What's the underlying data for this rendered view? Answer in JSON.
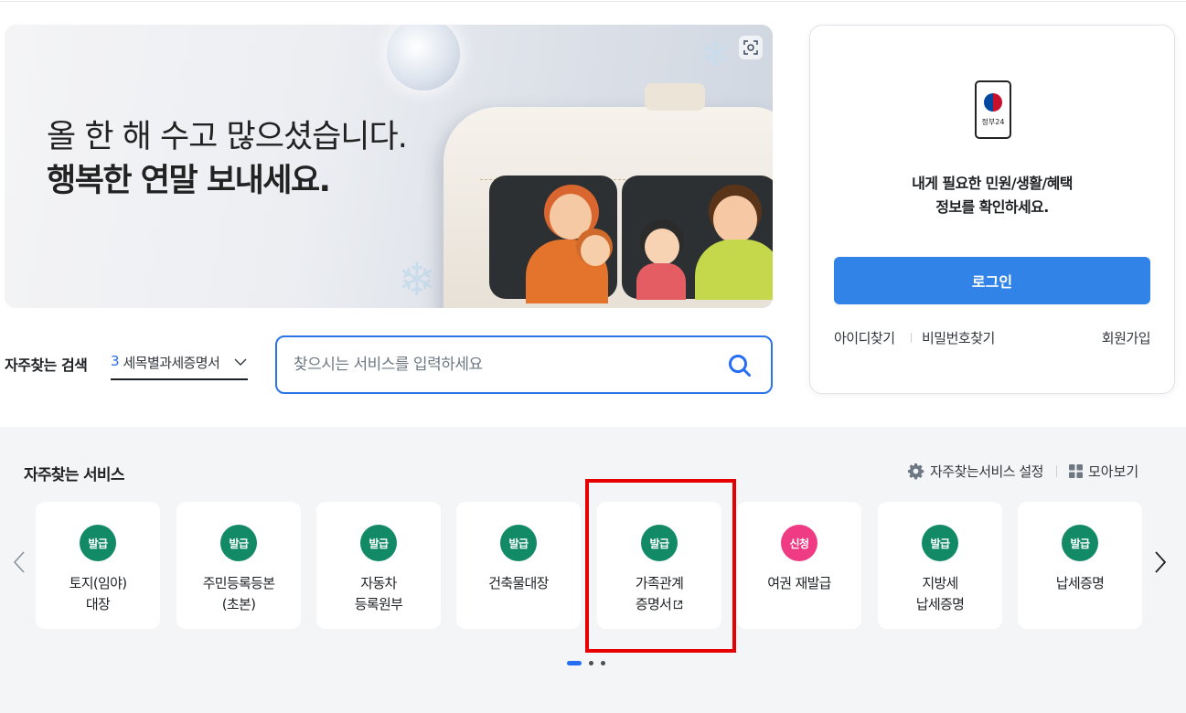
{
  "banner": {
    "line1": "올 한 해 수고 많으셨습니다.",
    "line2": "행복한 연말 보내세요."
  },
  "search": {
    "label": "자주찾는 검색",
    "rank_number": "3",
    "rank_text": "세목별과세증명서",
    "placeholder": "찾으시는 서비스를 입력하세요"
  },
  "login": {
    "app_label": "정부24",
    "desc_line1": "내게 필요한 민원/생활/혜택",
    "desc_line2": "정보를 확인하세요.",
    "button": "로그인",
    "find_id": "아이디찾기",
    "find_pw": "비밀번호찾기",
    "signup": "회원가입"
  },
  "services": {
    "title": "자주찾는 서비스",
    "settings_label": "자주찾는서비스 설정",
    "view_all_label": "모아보기",
    "cards": [
      {
        "badge": "발급",
        "line1": "토지(임야)",
        "line2": "대장"
      },
      {
        "badge": "발급",
        "line1": "주민등록등본",
        "line2": "(초본)"
      },
      {
        "badge": "발급",
        "line1": "자동차",
        "line2": "등록원부"
      },
      {
        "badge": "발급",
        "line1": "건축물대장",
        "line2": ""
      },
      {
        "badge": "발급",
        "line1": "가족관계",
        "line2": "증명서"
      },
      {
        "badge": "신청",
        "line1": "여권 재발급",
        "line2": ""
      },
      {
        "badge": "발급",
        "line1": "지방세",
        "line2": "납세증명"
      },
      {
        "badge": "발급",
        "line1": "납세증명",
        "line2": ""
      }
    ]
  },
  "colors": {
    "primary": "#3183e7",
    "badge_green": "#118a65",
    "badge_pink": "#ef3b84",
    "highlight": "#e60000"
  }
}
